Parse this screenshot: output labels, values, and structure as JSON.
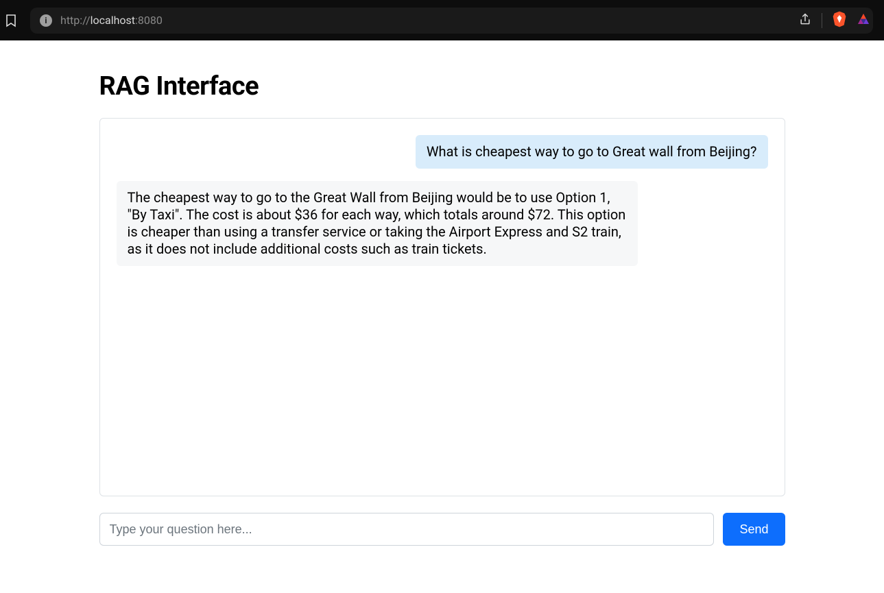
{
  "browser": {
    "url_protocol": "http://",
    "url_host": "localhost",
    "url_port": ":8080",
    "site_info_glyph": "i"
  },
  "page": {
    "title": "RAG Interface"
  },
  "chat": {
    "messages": [
      {
        "role": "user",
        "text": "What is cheapest way to go to Great wall from Beijing?"
      },
      {
        "role": "assistant",
        "text": "The cheapest way to go to the Great Wall from Beijing would be to use Option 1, \"By Taxi\". The cost is about $36 for each way, which totals around $72. This option is cheaper than using a transfer service or taking the Airport Express and S2 train, as it does not include additional costs such as train tickets."
      }
    ]
  },
  "composer": {
    "placeholder": "Type your question here...",
    "value": "",
    "send_label": "Send"
  }
}
